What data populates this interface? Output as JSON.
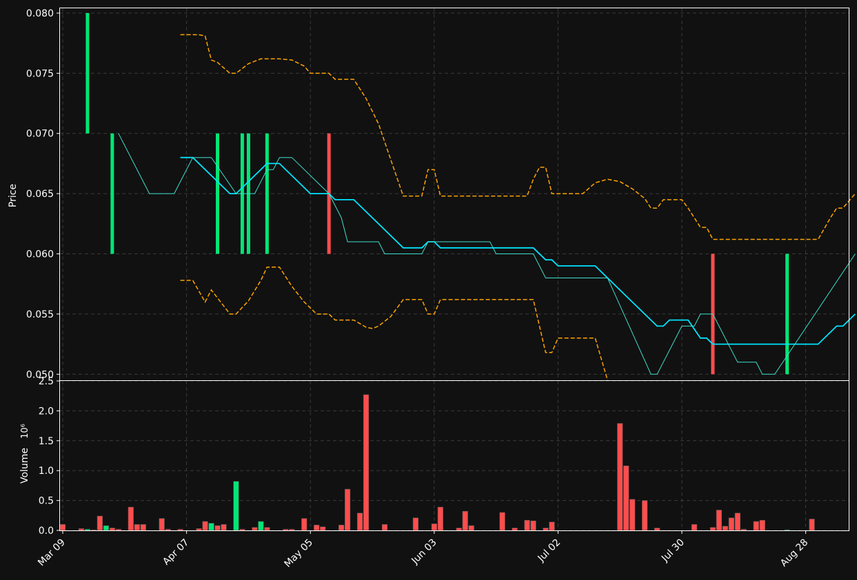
{
  "colors": {
    "background": "#111111",
    "axis": "#ffffff",
    "grid": "#3a3a3a",
    "up": "#00e676",
    "down": "#ff4d4d",
    "ma_fast": "#00e5ff",
    "ma_slow": "#40e0d0",
    "bands": "#ffa500"
  },
  "chart_data": [
    {
      "type": "candlestick",
      "ylabel": "Price",
      "ylim": [
        0.0495,
        0.0804
      ],
      "yticks": [
        "0.050",
        "0.055",
        "0.060",
        "0.065",
        "0.070",
        "0.075",
        "0.080"
      ],
      "xticks": [
        "Mar 09",
        "Apr 07",
        "May 05",
        "Jun 03",
        "Jul 02",
        "Jul 30",
        "Aug 28"
      ],
      "grid": true,
      "candles": [
        {
          "x": 4,
          "open": 0.07,
          "close": 0.08,
          "dir": "up"
        },
        {
          "x": 8,
          "open": 0.06,
          "close": 0.07,
          "dir": "up"
        },
        {
          "x": 25,
          "open": 0.06,
          "close": 0.07,
          "dir": "up"
        },
        {
          "x": 29,
          "open": 0.06,
          "close": 0.07,
          "dir": "up"
        },
        {
          "x": 30,
          "open": 0.06,
          "close": 0.07,
          "dir": "up"
        },
        {
          "x": 33,
          "open": 0.06,
          "close": 0.07,
          "dir": "up"
        },
        {
          "x": 43,
          "open": 0.07,
          "close": 0.06,
          "dir": "down"
        },
        {
          "x": 105,
          "open": 0.06,
          "close": 0.05,
          "dir": "down"
        },
        {
          "x": 117,
          "open": 0.05,
          "close": 0.06,
          "dir": "up"
        }
      ],
      "series": [
        {
          "name": "ma_fast",
          "points": [
            [
              19,
              0.068
            ],
            [
              21,
              0.068
            ],
            [
              27,
              0.065
            ],
            [
              28,
              0.065
            ],
            [
              33,
              0.0675
            ],
            [
              35,
              0.0675
            ],
            [
              40,
              0.065
            ],
            [
              43,
              0.065
            ],
            [
              44,
              0.0645
            ],
            [
              47,
              0.0645
            ],
            [
              55,
              0.0605
            ],
            [
              58,
              0.0605
            ],
            [
              59,
              0.061
            ],
            [
              60,
              0.061
            ],
            [
              61,
              0.0605
            ],
            [
              76,
              0.0605
            ],
            [
              78,
              0.0595
            ],
            [
              79,
              0.0595
            ],
            [
              80,
              0.059
            ],
            [
              86,
              0.059
            ],
            [
              88,
              0.058
            ],
            [
              96,
              0.054
            ],
            [
              97,
              0.054
            ],
            [
              98,
              0.0545
            ],
            [
              101,
              0.0545
            ],
            [
              103,
              0.053
            ],
            [
              104,
              0.053
            ],
            [
              105,
              0.0525
            ],
            [
              122,
              0.0525
            ],
            [
              125,
              0.054
            ],
            [
              126,
              0.054
            ],
            [
              128,
              0.055
            ]
          ]
        },
        {
          "name": "ma_slow",
          "points": [
            [
              9,
              0.07
            ],
            [
              14,
              0.065
            ],
            [
              18,
              0.065
            ],
            [
              21,
              0.068
            ],
            [
              24,
              0.068
            ],
            [
              28,
              0.065
            ],
            [
              31,
              0.065
            ],
            [
              33,
              0.067
            ],
            [
              34,
              0.067
            ],
            [
              35,
              0.068
            ],
            [
              37,
              0.068
            ],
            [
              43,
              0.065
            ],
            [
              45,
              0.063
            ],
            [
              46,
              0.061
            ],
            [
              51,
              0.061
            ],
            [
              52,
              0.06
            ],
            [
              58,
              0.06
            ],
            [
              59,
              0.061
            ],
            [
              69,
              0.061
            ],
            [
              70,
              0.06
            ],
            [
              76,
              0.06
            ],
            [
              78,
              0.058
            ],
            [
              88,
              0.058
            ],
            [
              95,
              0.05
            ],
            [
              96,
              0.05
            ],
            [
              100,
              0.054
            ],
            [
              102,
              0.054
            ],
            [
              103,
              0.055
            ],
            [
              105,
              0.055
            ],
            [
              109,
              0.051
            ],
            [
              112,
              0.051
            ],
            [
              113,
              0.05
            ],
            [
              115,
              0.05
            ],
            [
              128,
              0.06
            ]
          ]
        },
        {
          "name": "upper_band",
          "points": [
            [
              19,
              0.0782
            ],
            [
              22,
              0.0782
            ],
            [
              23,
              0.0781
            ],
            [
              24,
              0.0761
            ],
            [
              25,
              0.0759
            ],
            [
              27,
              0.075
            ],
            [
              28,
              0.075
            ],
            [
              30,
              0.0758
            ],
            [
              32,
              0.0762
            ],
            [
              35,
              0.0762
            ],
            [
              37,
              0.0761
            ],
            [
              39,
              0.0756
            ],
            [
              40,
              0.075
            ],
            [
              43,
              0.075
            ],
            [
              44,
              0.0745
            ],
            [
              47,
              0.0745
            ],
            [
              49,
              0.0729
            ],
            [
              51,
              0.0708
            ],
            [
              53,
              0.0678
            ],
            [
              55,
              0.0648
            ],
            [
              58,
              0.0648
            ],
            [
              59,
              0.067
            ],
            [
              60,
              0.067
            ],
            [
              61,
              0.0648
            ],
            [
              75,
              0.0648
            ],
            [
              76,
              0.0662
            ],
            [
              77,
              0.0672
            ],
            [
              78,
              0.0672
            ],
            [
              79,
              0.065
            ],
            [
              84,
              0.065
            ],
            [
              86,
              0.0659
            ],
            [
              88,
              0.0662
            ],
            [
              90,
              0.066
            ],
            [
              92,
              0.0654
            ],
            [
              94,
              0.0646
            ],
            [
              95,
              0.0638
            ],
            [
              96,
              0.0638
            ],
            [
              97,
              0.0645
            ],
            [
              100,
              0.0645
            ],
            [
              101,
              0.0638
            ],
            [
              103,
              0.0622
            ],
            [
              104,
              0.0622
            ],
            [
              105,
              0.0612
            ],
            [
              122,
              0.0612
            ],
            [
              124,
              0.063
            ],
            [
              125,
              0.0638
            ],
            [
              126,
              0.0638
            ],
            [
              128,
              0.065
            ]
          ]
        },
        {
          "name": "lower_band",
          "points": [
            [
              19,
              0.0578
            ],
            [
              21,
              0.0578
            ],
            [
              23,
              0.056
            ],
            [
              24,
              0.057
            ],
            [
              27,
              0.055
            ],
            [
              28,
              0.055
            ],
            [
              30,
              0.0561
            ],
            [
              32,
              0.0578
            ],
            [
              33,
              0.0589
            ],
            [
              35,
              0.0589
            ],
            [
              37,
              0.0573
            ],
            [
              39,
              0.056
            ],
            [
              40,
              0.0555
            ],
            [
              41,
              0.055
            ],
            [
              43,
              0.055
            ],
            [
              44,
              0.0545
            ],
            [
              47,
              0.0545
            ],
            [
              49,
              0.0539
            ],
            [
              50,
              0.0538
            ],
            [
              51,
              0.054
            ],
            [
              53,
              0.0548
            ],
            [
              55,
              0.0562
            ],
            [
              58,
              0.0562
            ],
            [
              59,
              0.055
            ],
            [
              60,
              0.055
            ],
            [
              61,
              0.0562
            ],
            [
              76,
              0.0562
            ],
            [
              78,
              0.0518
            ],
            [
              79,
              0.0518
            ],
            [
              80,
              0.053
            ],
            [
              86,
              0.053
            ],
            [
              88,
              0.0495
            ]
          ]
        }
      ]
    },
    {
      "type": "bar",
      "ylabel": "Volume",
      "scale_label": "10⁶",
      "ylim": [
        0,
        2.5
      ],
      "yticks": [
        "0.0",
        "0.5",
        "1.0",
        "1.5",
        "2.0",
        "2.5"
      ],
      "grid": true,
      "bars": [
        {
          "x": 0,
          "v": 0.1,
          "dir": "down"
        },
        {
          "x": 3,
          "v": 0.03,
          "dir": "down"
        },
        {
          "x": 4,
          "v": 0.02,
          "dir": "up"
        },
        {
          "x": 5,
          "v": 0.01,
          "dir": "down"
        },
        {
          "x": 6,
          "v": 0.24,
          "dir": "down"
        },
        {
          "x": 7,
          "v": 0.08,
          "dir": "up"
        },
        {
          "x": 8,
          "v": 0.04,
          "dir": "down"
        },
        {
          "x": 9,
          "v": 0.02,
          "dir": "down"
        },
        {
          "x": 11,
          "v": 0.39,
          "dir": "down"
        },
        {
          "x": 12,
          "v": 0.1,
          "dir": "down"
        },
        {
          "x": 13,
          "v": 0.1,
          "dir": "down"
        },
        {
          "x": 16,
          "v": 0.2,
          "dir": "down"
        },
        {
          "x": 17,
          "v": 0.02,
          "dir": "down"
        },
        {
          "x": 19,
          "v": 0.02,
          "dir": "down"
        },
        {
          "x": 22,
          "v": 0.03,
          "dir": "down"
        },
        {
          "x": 23,
          "v": 0.15,
          "dir": "down"
        },
        {
          "x": 24,
          "v": 0.12,
          "dir": "up"
        },
        {
          "x": 25,
          "v": 0.08,
          "dir": "down"
        },
        {
          "x": 26,
          "v": 0.1,
          "dir": "down"
        },
        {
          "x": 28,
          "v": 0.82,
          "dir": "up"
        },
        {
          "x": 29,
          "v": 0.02,
          "dir": "down"
        },
        {
          "x": 31,
          "v": 0.05,
          "dir": "down"
        },
        {
          "x": 32,
          "v": 0.15,
          "dir": "up"
        },
        {
          "x": 33,
          "v": 0.05,
          "dir": "down"
        },
        {
          "x": 36,
          "v": 0.02,
          "dir": "down"
        },
        {
          "x": 37,
          "v": 0.02,
          "dir": "down"
        },
        {
          "x": 39,
          "v": 0.2,
          "dir": "down"
        },
        {
          "x": 41,
          "v": 0.09,
          "dir": "down"
        },
        {
          "x": 42,
          "v": 0.06,
          "dir": "down"
        },
        {
          "x": 45,
          "v": 0.09,
          "dir": "down"
        },
        {
          "x": 46,
          "v": 0.69,
          "dir": "down"
        },
        {
          "x": 48,
          "v": 0.29,
          "dir": "down"
        },
        {
          "x": 49,
          "v": 2.27,
          "dir": "down"
        },
        {
          "x": 52,
          "v": 0.1,
          "dir": "down"
        },
        {
          "x": 57,
          "v": 0.21,
          "dir": "down"
        },
        {
          "x": 60,
          "v": 0.11,
          "dir": "down"
        },
        {
          "x": 61,
          "v": 0.39,
          "dir": "down"
        },
        {
          "x": 64,
          "v": 0.04,
          "dir": "down"
        },
        {
          "x": 65,
          "v": 0.32,
          "dir": "down"
        },
        {
          "x": 66,
          "v": 0.08,
          "dir": "down"
        },
        {
          "x": 71,
          "v": 0.3,
          "dir": "down"
        },
        {
          "x": 73,
          "v": 0.04,
          "dir": "down"
        },
        {
          "x": 75,
          "v": 0.17,
          "dir": "down"
        },
        {
          "x": 76,
          "v": 0.16,
          "dir": "down"
        },
        {
          "x": 78,
          "v": 0.04,
          "dir": "down"
        },
        {
          "x": 79,
          "v": 0.14,
          "dir": "down"
        },
        {
          "x": 90,
          "v": 1.79,
          "dir": "down"
        },
        {
          "x": 91,
          "v": 1.08,
          "dir": "down"
        },
        {
          "x": 92,
          "v": 0.52,
          "dir": "down"
        },
        {
          "x": 94,
          "v": 0.5,
          "dir": "down"
        },
        {
          "x": 96,
          "v": 0.04,
          "dir": "down"
        },
        {
          "x": 102,
          "v": 0.1,
          "dir": "down"
        },
        {
          "x": 105,
          "v": 0.05,
          "dir": "down"
        },
        {
          "x": 106,
          "v": 0.34,
          "dir": "down"
        },
        {
          "x": 107,
          "v": 0.07,
          "dir": "down"
        },
        {
          "x": 108,
          "v": 0.21,
          "dir": "down"
        },
        {
          "x": 109,
          "v": 0.29,
          "dir": "down"
        },
        {
          "x": 110,
          "v": 0.02,
          "dir": "down"
        },
        {
          "x": 112,
          "v": 0.15,
          "dir": "down"
        },
        {
          "x": 113,
          "v": 0.17,
          "dir": "down"
        },
        {
          "x": 117,
          "v": 0.01,
          "dir": "up"
        },
        {
          "x": 121,
          "v": 0.19,
          "dir": "down"
        }
      ]
    }
  ]
}
